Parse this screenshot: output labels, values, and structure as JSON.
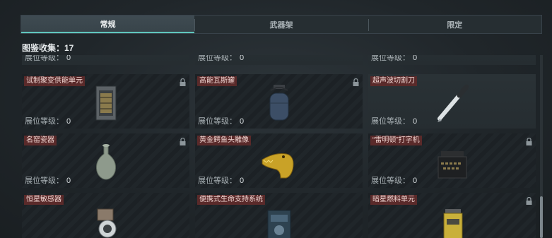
{
  "tabs": [
    {
      "label": "常规"
    },
    {
      "label": "武器架"
    },
    {
      "label": "限定"
    }
  ],
  "collection": {
    "text": "图鉴收集：17"
  },
  "level_label": "展位等级：",
  "rows": [
    {
      "cards": [
        {
          "name": "",
          "level": "0",
          "locked": false
        },
        {
          "name": "",
          "level": "0",
          "locked": false
        },
        {
          "name": "",
          "level": "0",
          "locked": false
        }
      ]
    },
    {
      "cards": [
        {
          "name": "试制聚变供能单元",
          "level": "0",
          "locked": true,
          "icon": "fusion-unit-icon"
        },
        {
          "name": "高能瓦斯罐",
          "level": "0",
          "locked": true,
          "icon": "gas-tank-icon"
        },
        {
          "name": "超声波切割刀",
          "level": "0",
          "locked": false,
          "icon": "ultrasonic-knife-icon"
        }
      ]
    },
    {
      "cards": [
        {
          "name": "名窑瓷器",
          "level": "0",
          "locked": true,
          "icon": "porcelain-vase-icon"
        },
        {
          "name": "黄金鳄鱼头雕像",
          "level": "0",
          "locked": false,
          "icon": "golden-croc-icon"
        },
        {
          "name": "“雷明顿”打字机",
          "level": "0",
          "locked": true,
          "icon": "typewriter-icon"
        }
      ]
    },
    {
      "cards": [
        {
          "name": "恒星敏感器",
          "level": "",
          "locked": false,
          "icon": "star-sensor-icon"
        },
        {
          "name": "便携式生命支持系统",
          "level": "",
          "locked": false,
          "icon": "life-support-icon"
        },
        {
          "name": "暗星燃料单元",
          "level": "",
          "locked": true,
          "icon": "fuel-cell-icon"
        }
      ]
    }
  ],
  "colors": {
    "accent": "#5fc7bd",
    "name_bg": "#5a2a2a",
    "gold": "#c9a227"
  }
}
